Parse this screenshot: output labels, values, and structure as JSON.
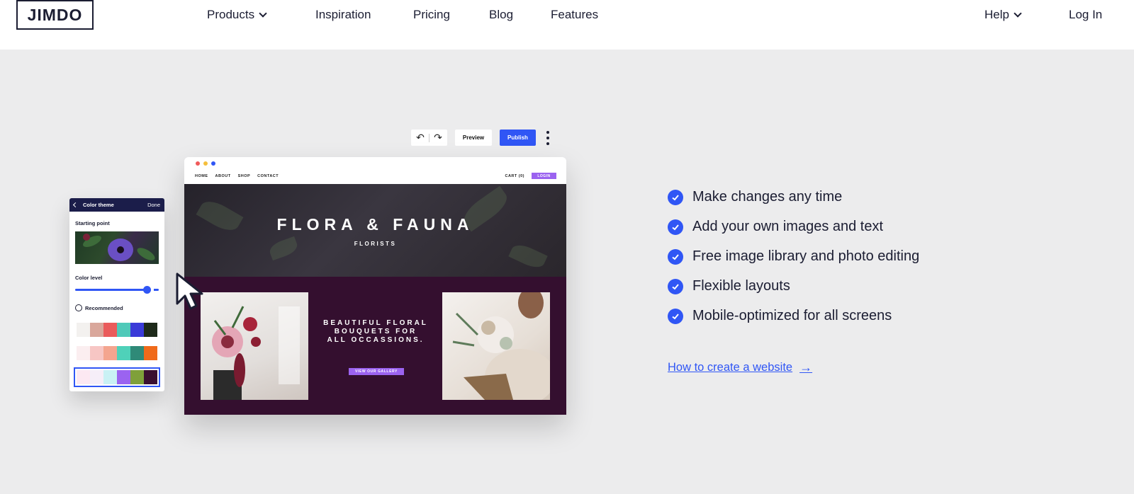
{
  "header": {
    "logo": "JIMDO",
    "nav": [
      {
        "label": "Products",
        "dropdown": true
      },
      {
        "label": "Inspiration"
      },
      {
        "label": "Pricing"
      },
      {
        "label": "Blog"
      },
      {
        "label": "Features"
      }
    ],
    "help": "Help",
    "login": "Log In"
  },
  "editor": {
    "undo_icon": "undo-icon",
    "redo_icon": "redo-icon",
    "preview": "Preview",
    "publish": "Publish",
    "more_icon": "more-vertical-icon",
    "accent": "#3056f5"
  },
  "mockup": {
    "window_dots": [
      "#f05a5a",
      "#f5bf3c",
      "#3056f5"
    ],
    "nav": [
      "HOME",
      "ABOUT",
      "SHOP",
      "CONTACT"
    ],
    "cart": "CART (0)",
    "login": "LOGIN",
    "title": "FLORA & FAUNA",
    "subtitle": "FLORISTS",
    "tagline": "BEAUTIFUL FLORAL BOUQUETS FOR ALL OCCASSIONS.",
    "gallery_button": "VIEW OUR GALLERY",
    "brand_color": "#340f2f",
    "button_color": "#9b63f0"
  },
  "color_panel": {
    "title": "Color theme",
    "done": "Done",
    "starting_point": "Starting point",
    "color_level": "Color level",
    "color_level_value": 0.86,
    "recommended": "Recommended",
    "palettes": [
      [
        "#f3f1ef",
        "#d9a79b",
        "#ea5b5b",
        "#4fc9b9",
        "#3a3bd8",
        "#1e2a1a"
      ],
      [
        "#fbeef0",
        "#f7c6c4",
        "#f4a58f",
        "#4fd1b9",
        "#2f8a78",
        "#f06a1a"
      ],
      [
        "#fce8f2",
        "#f6eef8",
        "#c9f1f4",
        "#9b63f0",
        "#7fa03a",
        "#3a0f30"
      ]
    ],
    "selected_palette": 2
  },
  "features": [
    "Make changes any time",
    "Add your own images and text",
    "Free image library and photo editing",
    "Flexible layouts",
    "Mobile-optimized for all screens"
  ],
  "cta": {
    "label": "How to create a website",
    "icon": "arrow-right-icon"
  }
}
